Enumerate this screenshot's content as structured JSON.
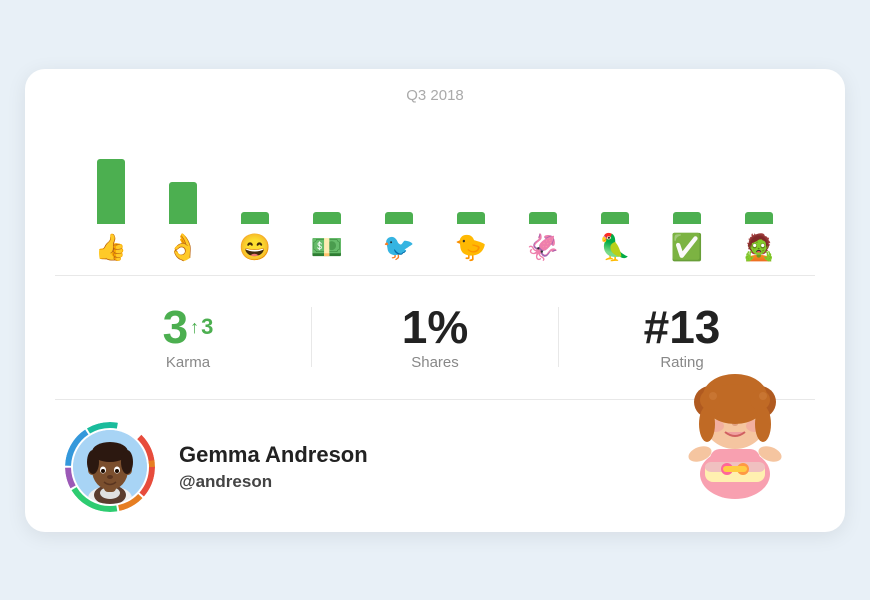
{
  "header": {
    "period_label": "Q3 2018"
  },
  "chart": {
    "bars": [
      {
        "height": 65,
        "emoji": "👍"
      },
      {
        "height": 42,
        "emoji": "👌"
      },
      {
        "height": 12,
        "emoji": "😄"
      },
      {
        "height": 12,
        "emoji": "💵"
      },
      {
        "height": 12,
        "emoji": "🐦"
      },
      {
        "height": 12,
        "emoji": "🐤"
      },
      {
        "height": 12,
        "emoji": "🦑"
      },
      {
        "height": 12,
        "emoji": "🦜"
      },
      {
        "height": 12,
        "emoji": "✅"
      },
      {
        "height": 12,
        "emoji": "🧟"
      }
    ]
  },
  "stats": [
    {
      "value": "3",
      "arrow": "↑",
      "small": "3",
      "label": "Karma",
      "green": true
    },
    {
      "value": "1%",
      "label": "Shares",
      "green": false
    },
    {
      "value": "#13",
      "label": "Rating",
      "green": false
    }
  ],
  "profile": {
    "name": "Gemma Andreson",
    "handle": "@andreson",
    "avatar_emoji": "👩🏾"
  },
  "colors": {
    "green": "#4caf50",
    "ring_colors": [
      "#e74c3c",
      "#e67e22",
      "#2ecc71",
      "#9b59b6",
      "#3498db",
      "#1abc9c"
    ]
  }
}
